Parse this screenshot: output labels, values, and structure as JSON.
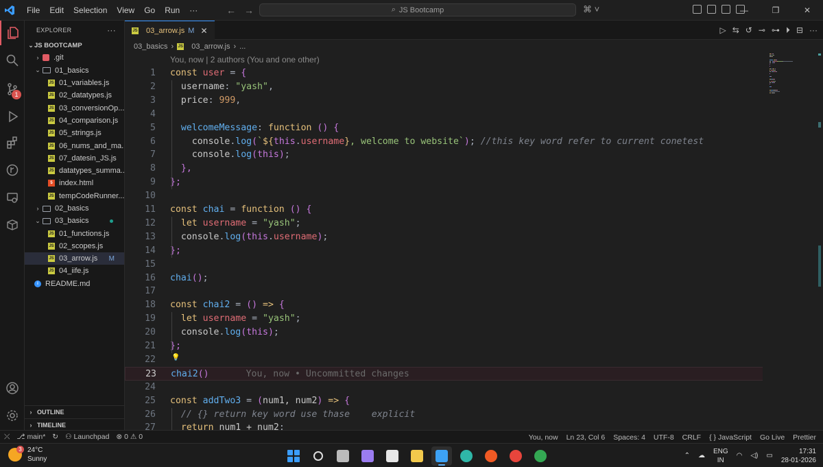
{
  "titlebar": {
    "menu": [
      "File",
      "Edit",
      "Selection",
      "View",
      "Go",
      "Run",
      "···"
    ],
    "search": "JS Bootcamp"
  },
  "sidebar": {
    "header": "EXPLORER",
    "workspace": "JS BOOTCAMP",
    "items": [
      {
        "label": ".git",
        "kind": "git",
        "depth": 1,
        "chev": "›"
      },
      {
        "label": "01_basics",
        "kind": "folder-open",
        "depth": 1,
        "chev": "⌄"
      },
      {
        "label": "01_variables.js",
        "kind": "js",
        "depth": 2
      },
      {
        "label": "02_datatypes.js",
        "kind": "js",
        "depth": 2
      },
      {
        "label": "03_conversionOp...",
        "kind": "js",
        "depth": 2
      },
      {
        "label": "04_comparison.js",
        "kind": "js",
        "depth": 2
      },
      {
        "label": "05_strings.js",
        "kind": "js",
        "depth": 2
      },
      {
        "label": "06_nums_and_ma...",
        "kind": "js",
        "depth": 2
      },
      {
        "label": "07_datesin_JS.js",
        "kind": "js",
        "depth": 2
      },
      {
        "label": "datatypes_summa...",
        "kind": "js",
        "depth": 2
      },
      {
        "label": "index.html",
        "kind": "html",
        "depth": 2
      },
      {
        "label": "tempCodeRunner...",
        "kind": "js",
        "depth": 2
      },
      {
        "label": "02_basics",
        "kind": "folder",
        "depth": 1,
        "chev": "›"
      },
      {
        "label": "03_basics",
        "kind": "folder-open",
        "depth": 1,
        "chev": "⌄",
        "dot": true
      },
      {
        "label": "01_functions.js",
        "kind": "js",
        "depth": 2
      },
      {
        "label": "02_scopes.js",
        "kind": "js",
        "depth": 2
      },
      {
        "label": "03_arrow.js",
        "kind": "js",
        "depth": 2,
        "selected": true,
        "badge": "M"
      },
      {
        "label": "04_iife.js",
        "kind": "js",
        "depth": 2
      },
      {
        "label": "README.md",
        "kind": "info",
        "depth": 1
      }
    ],
    "outline": "OUTLINE",
    "timeline": "TIMELINE"
  },
  "activity": {
    "scm_badge": "1"
  },
  "editor": {
    "tab_label": "03_arrow.js",
    "tab_badge": "M",
    "breadcrumb": [
      "03_basics",
      "03_arrow.js",
      "..."
    ],
    "blame": "You, now | 2 authors (You and one other)",
    "inline_blame": "You, now • Uncommitted changes",
    "current_line": 23,
    "lines": [
      [
        [
          "k",
          "const "
        ],
        [
          "v",
          "user"
        ],
        [
          "pl",
          " = "
        ],
        [
          "p",
          "{"
        ]
      ],
      [
        [
          "t",
          "  username"
        ],
        [
          "pl",
          ": "
        ],
        [
          "s",
          "\"yash\""
        ],
        [
          "pl",
          ","
        ]
      ],
      [
        [
          "t",
          "  price"
        ],
        [
          "pl",
          ": "
        ],
        [
          "n",
          "999"
        ],
        [
          "pl",
          ","
        ]
      ],
      [],
      [
        [
          "f",
          "  welcomeMessage"
        ],
        [
          "pl",
          ": "
        ],
        [
          "k",
          "function "
        ],
        [
          "p",
          "() {"
        ]
      ],
      [
        [
          "t",
          "    console"
        ],
        [
          "pl",
          "."
        ],
        [
          "f",
          "log"
        ],
        [
          "p",
          "("
        ],
        [
          "s",
          "`"
        ],
        [
          "k",
          "${"
        ],
        [
          "p",
          "this"
        ],
        [
          "pl",
          "."
        ],
        [
          "v",
          "username"
        ],
        [
          "k",
          "}"
        ],
        [
          "s",
          ", welcome to website`"
        ],
        [
          "p",
          ")"
        ],
        [
          "pl",
          "; "
        ],
        [
          "c",
          "//this key word refer to current conetest"
        ]
      ],
      [
        [
          "t",
          "    console"
        ],
        [
          "pl",
          "."
        ],
        [
          "f",
          "log"
        ],
        [
          "p",
          "("
        ],
        [
          "p",
          "this"
        ],
        [
          "p",
          ")"
        ],
        [
          "pl",
          ";"
        ]
      ],
      [
        [
          "p",
          "  },"
        ]
      ],
      [
        [
          "p",
          "};"
        ]
      ],
      [],
      [
        [
          "k",
          "const "
        ],
        [
          "f",
          "chai"
        ],
        [
          "pl",
          " = "
        ],
        [
          "k",
          "function "
        ],
        [
          "p",
          "() {"
        ]
      ],
      [
        [
          "k",
          "  let "
        ],
        [
          "v",
          "username"
        ],
        [
          "pl",
          " = "
        ],
        [
          "s",
          "\"yash\""
        ],
        [
          "pl",
          ";"
        ]
      ],
      [
        [
          "t",
          "  console"
        ],
        [
          "pl",
          "."
        ],
        [
          "f",
          "log"
        ],
        [
          "p",
          "("
        ],
        [
          "p",
          "this"
        ],
        [
          "pl",
          "."
        ],
        [
          "v",
          "username"
        ],
        [
          "p",
          ")"
        ],
        [
          "pl",
          ";"
        ]
      ],
      [
        [
          "p",
          "};"
        ]
      ],
      [],
      [
        [
          "f",
          "chai"
        ],
        [
          "p",
          "()"
        ],
        [
          "pl",
          ";"
        ]
      ],
      [],
      [
        [
          "k",
          "const "
        ],
        [
          "f",
          "chai2"
        ],
        [
          "pl",
          " = "
        ],
        [
          "p",
          "() "
        ],
        [
          "k",
          "=> "
        ],
        [
          "p",
          "{"
        ]
      ],
      [
        [
          "k",
          "  let "
        ],
        [
          "v",
          "username"
        ],
        [
          "pl",
          " = "
        ],
        [
          "s",
          "\"yash\""
        ],
        [
          "pl",
          ";"
        ]
      ],
      [
        [
          "t",
          "  console"
        ],
        [
          "pl",
          "."
        ],
        [
          "f",
          "log"
        ],
        [
          "p",
          "("
        ],
        [
          "p",
          "this"
        ],
        [
          "p",
          ")"
        ],
        [
          "pl",
          ";"
        ]
      ],
      [
        [
          "p",
          "};"
        ]
      ],
      [],
      [
        [
          "f",
          "chai2"
        ],
        [
          "p",
          "()"
        ]
      ],
      [],
      [
        [
          "k",
          "const "
        ],
        [
          "f",
          "addTwo3"
        ],
        [
          "pl",
          " = "
        ],
        [
          "p",
          "("
        ],
        [
          "t",
          "num1, num2"
        ],
        [
          "p",
          ") "
        ],
        [
          "k",
          "=> "
        ],
        [
          "p",
          "{"
        ]
      ],
      [
        [
          "c",
          "  // {} return key word use thase    explicit"
        ]
      ],
      [
        [
          "k",
          "  return "
        ],
        [
          "t",
          "num1 + num2"
        ],
        [
          "pl",
          ";"
        ]
      ]
    ]
  },
  "statusbar": {
    "left": [
      "main*",
      "Launchpad",
      "⊗ 0 ⚠ 0"
    ],
    "right": [
      "You, now",
      "Ln 23, Col 6",
      "Spaces: 4",
      "UTF-8",
      "CRLF",
      "{ } JavaScript",
      "Go Live",
      "Prettier"
    ]
  },
  "taskbar": {
    "temp": "24°C",
    "weather": "Sunny",
    "weather_badge": "3",
    "lang1": "ENG",
    "lang2": "IN",
    "time": "17:31",
    "date": "28-01-2026",
    "apps": [
      {
        "name": "start-button",
        "color": "#3b9dff"
      },
      {
        "name": "search-app",
        "color": "#dddddd"
      },
      {
        "name": "task-view",
        "color": "#bbbbbb"
      },
      {
        "name": "copilot-app",
        "color": "#9b7cf0"
      },
      {
        "name": "store-app",
        "color": "#e6e6e6"
      },
      {
        "name": "file-explorer-app",
        "color": "#f2c94c"
      },
      {
        "name": "vscode-app",
        "color": "#3da2f5",
        "active": true
      },
      {
        "name": "edge-app",
        "color": "#2fb7a8"
      },
      {
        "name": "brave-app",
        "color": "#f15a24"
      },
      {
        "name": "chrome-app",
        "color": "#e8453c"
      },
      {
        "name": "chrome-profile-app",
        "color": "#34a853"
      }
    ]
  }
}
